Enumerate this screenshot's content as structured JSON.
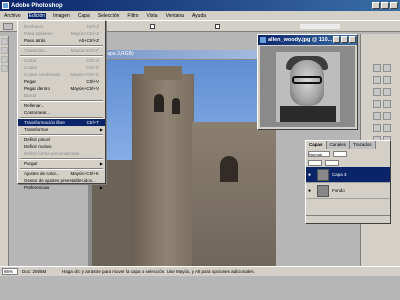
{
  "app": {
    "title": "Adobe Photoshop"
  },
  "menubar": [
    "Archivo",
    "Edición",
    "Imagen",
    "Capa",
    "Selección",
    "Filtro",
    "Vista",
    "Ventana",
    "Ayuda"
  ],
  "document": {
    "title_fragment": "(Capa 3,RGB)"
  },
  "edit_menu": [
    {
      "label": "Deshacer",
      "shortcut": "Ctrl+Z",
      "disabled": true
    },
    {
      "label": "Paso adelante",
      "shortcut": "Mayús+Ctrl+Z",
      "disabled": true
    },
    {
      "label": "Paso atrás",
      "shortcut": "Alt+Ctrl+Z",
      "disabled": false
    },
    {
      "sep": true
    },
    {
      "label": "Transición...",
      "shortcut": "Mayús+Ctrl+F",
      "disabled": true
    },
    {
      "sep": true
    },
    {
      "label": "Cortar",
      "shortcut": "Ctrl+X",
      "disabled": true
    },
    {
      "label": "Copiar",
      "shortcut": "Ctrl+C",
      "disabled": true
    },
    {
      "label": "Copiar combinado",
      "shortcut": "Mayús+Ctrl+C",
      "disabled": true
    },
    {
      "label": "Pegar",
      "shortcut": "Ctrl+V",
      "disabled": false
    },
    {
      "label": "Pegar dentro",
      "shortcut": "Mayús+Ctrl+V",
      "disabled": false
    },
    {
      "label": "Borrar",
      "shortcut": "",
      "disabled": true
    },
    {
      "sep": true
    },
    {
      "label": "Rellenar...",
      "shortcut": "",
      "disabled": false
    },
    {
      "label": "Contornear...",
      "shortcut": "",
      "disabled": false
    },
    {
      "sep": true
    },
    {
      "label": "Transformación libre",
      "shortcut": "Ctrl+T",
      "disabled": false,
      "highlight": true
    },
    {
      "label": "Transformar",
      "shortcut": "",
      "disabled": false,
      "submenu": true
    },
    {
      "sep": true
    },
    {
      "label": "Definir pincel",
      "shortcut": "",
      "disabled": false
    },
    {
      "label": "Definir motivo",
      "shortcut": "",
      "disabled": false
    },
    {
      "label": "Definir forma personalizada",
      "shortcut": "",
      "disabled": true
    },
    {
      "sep": true
    },
    {
      "label": "Purgar",
      "shortcut": "",
      "disabled": false,
      "submenu": true
    },
    {
      "sep": true
    },
    {
      "label": "Ajustes de color...",
      "shortcut": "Mayús+Ctrl+K",
      "disabled": false
    },
    {
      "label": "Gestor de ajustes preestablecidos...",
      "shortcut": "",
      "disabled": false
    },
    {
      "label": "Preferencias",
      "shortcut": "",
      "disabled": false,
      "submenu": true
    }
  ],
  "image_window": {
    "title": "allen_woody.jpg @ 110..."
  },
  "layers_panel": {
    "tabs": [
      "Capas",
      "Canales",
      "Trazados"
    ],
    "blend_mode": "Normal",
    "layers": [
      {
        "name": "Capa 3",
        "active": true
      },
      {
        "name": "Fondo",
        "active": false
      }
    ]
  },
  "statusbar": {
    "zoom": "66%",
    "doc": "Doc: 2M/5M",
    "hint": "Haga clic y arrastre para mover la capa o selección. Use Mayús, y Alt para opciones adicionales."
  },
  "colors": {
    "title_bar": "#0a246a",
    "menu_bg": "#d4d0c8",
    "workspace": "#b6b6b6"
  }
}
